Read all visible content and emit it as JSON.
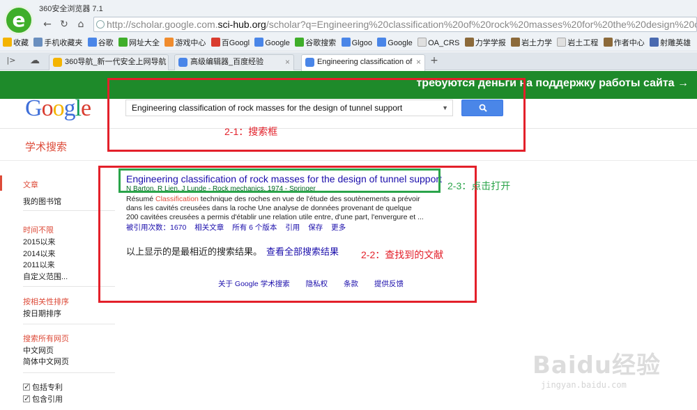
{
  "browser": {
    "title": "360安全浏览器 7.1",
    "address_prefix": "http://scholar.google.com.",
    "address_domain": "sci-hub.org",
    "address_rest": "/scholar?q=Engineering%20classification%20of%20rock%20masses%20for%20the%20design%20of%20tunnel",
    "bookmarks": [
      "收藏",
      "手机收藏夹",
      "谷歌",
      "网址大全",
      "游戏中心",
      "百Googl",
      "Google",
      "谷歌搜索",
      "Glgoo",
      "Google",
      "OA_CRS",
      "力学学报",
      "岩土力学",
      "岩土工程",
      "作者中心",
      "射雕英雄"
    ],
    "tabs": [
      {
        "label": "360导航_新一代安全上网导航"
      },
      {
        "label": "高级编辑器_百度经验"
      },
      {
        "label": "Engineering classification of"
      }
    ]
  },
  "banner": {
    "text": "требуются деньги на поддержку работы сайта →"
  },
  "logo": {
    "text": "Google"
  },
  "search": {
    "query": "Engineering classification of rock masses for the design of tunnel support"
  },
  "scholar_label": "学术搜索",
  "sidebar": {
    "articles": "文章",
    "my_library": "我的图书馆",
    "time_header": "时间不限",
    "since_2015": "2015以来",
    "since_2014": "2014以来",
    "since_2011": "2011以来",
    "custom_range": "自定义范围...",
    "sort_relevance": "按相关性排序",
    "sort_date": "按日期排序",
    "search_all": "搜索所有网页",
    "chinese_pages": "中文网页",
    "simplified_pages": "简体中文网页",
    "include_patents": "包括专利",
    "include_citations": "包含引用"
  },
  "result": {
    "title": "Engineering classification of rock masses for the design of tunnel support",
    "meta": "N Barton, R Lien, J Lunde - Rock mechanics, 1974 - Springer",
    "snippet_1_pre": "Résumé ",
    "snippet_1_hl": "Classification",
    "snippet_1_post": " technique des roches en vue de l'étude des soutènements a prévoir",
    "snippet_2": "dans les cavités creusées dans la roche Une analyse de données provenant de quelque",
    "snippet_3": "200 cavitées creusées a permis d'établir une relation utile entre, d'une part, l'envergure et ...",
    "cited_by": "被引用次数：1670",
    "related": "相关文章",
    "versions": "所有 6 个版本",
    "cite": "引用",
    "save": "保存",
    "more": "更多"
  },
  "summary": {
    "text": "以上显示的是最相近的搜索结果。",
    "link": "查看全部搜索结果"
  },
  "footer": {
    "about": "关于 Google 学术搜索",
    "privacy": "隐私权",
    "terms": "条款",
    "feedback": "提供反馈"
  },
  "annotations": {
    "search_box": "2-1：搜索框",
    "result_found": "2-2：查找到的文献",
    "click_open": "2-3：点击打开"
  },
  "watermark": {
    "main": "Baidu经验",
    "sub": "jingyan.baidu.com"
  },
  "colors": {
    "banner": "#1e8a2a",
    "annotation_red": "#e3202a",
    "annotation_green": "#2aa44a",
    "link": "#1a0dab",
    "scholar_red": "#dd4b39"
  }
}
